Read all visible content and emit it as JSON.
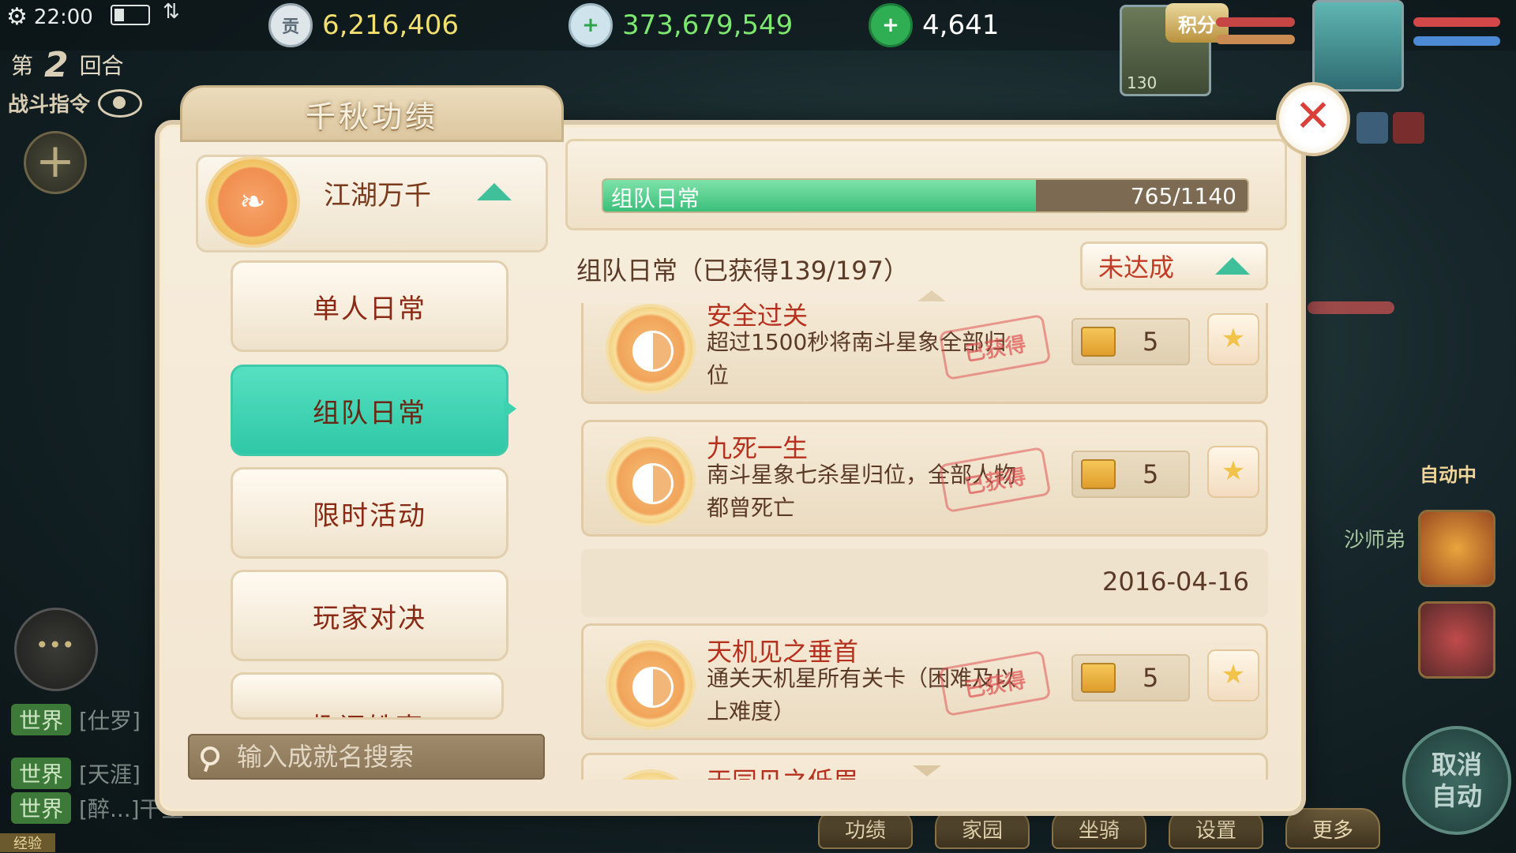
{
  "status_bar": {
    "time": "22:00"
  },
  "battle": {
    "round_prefix": "第",
    "round_number": "2",
    "round_suffix": "回合",
    "command_label": "战斗指令"
  },
  "currencies": [
    {
      "icon": "tribute-coin-icon",
      "icon_text": "贡",
      "value": "6,216,406",
      "color": "#f2df6e"
    },
    {
      "icon": "silver-ingot-icon",
      "icon_text": "",
      "value": "373,679,549",
      "color": "#7de86f"
    },
    {
      "icon": "jade-icon",
      "icon_text": "",
      "value": "4,641",
      "color": "#ffffff"
    }
  ],
  "score_badge": {
    "label": "积分",
    "level": "130"
  },
  "panel": {
    "title": "千秋功绩",
    "category": {
      "label": "江湖万千"
    },
    "sub_items": [
      {
        "label": "单人日常",
        "active": false
      },
      {
        "label": "组队日常",
        "active": true
      },
      {
        "label": "限时活动",
        "active": false
      },
      {
        "label": "玩家对决",
        "active": false
      },
      {
        "label": "趣闻轶事",
        "active": false
      }
    ],
    "search": {
      "placeholder": "输入成就名搜索",
      "value": ""
    },
    "progress": {
      "name": "组队日常",
      "current": 765,
      "total": 1140,
      "value_text": "765/1140"
    },
    "section_title": "组队日常（已获得139/197）",
    "status_filter": "未达成",
    "achievements": [
      {
        "name": "安全过关",
        "desc": "超过1500秒将南斗星象全部归位",
        "stamp": "已获得",
        "reward": "5"
      },
      {
        "name": "九死一生",
        "desc": "南斗星象七杀星归位，全部人物都曾死亡",
        "stamp": "已获得",
        "reward": "5"
      },
      {
        "name": "天机见之垂首",
        "desc": "通关天机星所有关卡（困难及以上难度）",
        "stamp": "已获得",
        "reward": "5"
      }
    ],
    "date": "2016-04-16",
    "next_item_partial": "天同见之低眉"
  },
  "right_hud": {
    "auto_label": "自动中",
    "npc_name": "沙师弟",
    "cancel_auto": "取消自动"
  },
  "bottom_buttons": [
    "功绩",
    "家园",
    "坐骑",
    "设置",
    "更多"
  ],
  "chat": [
    {
      "channel": "世界",
      "text": "[仕罗]"
    },
    {
      "channel": "世界",
      "text": "[天涯]"
    },
    {
      "channel": "世界",
      "text": "[醉...]干坐"
    }
  ],
  "exp_label": "经验",
  "colors": {
    "accent_teal": "#3ec9a8",
    "title_red": "#b5311d",
    "progress_green": "#3bbf7a"
  }
}
